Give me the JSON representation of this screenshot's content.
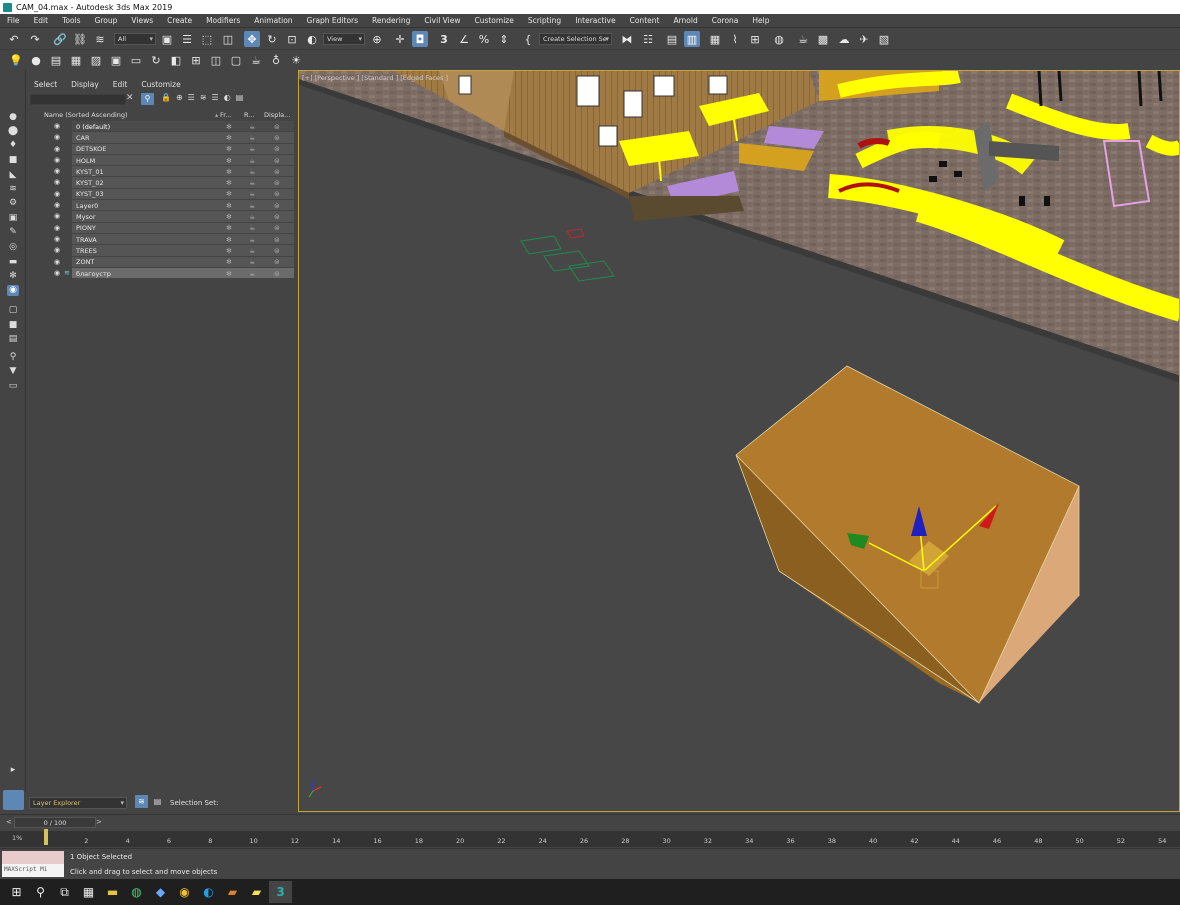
{
  "window": {
    "title": "CAM_04.max - Autodesk 3ds Max 2019"
  },
  "menu": [
    "File",
    "Edit",
    "Tools",
    "Group",
    "Views",
    "Create",
    "Modifiers",
    "Animation",
    "Graph Editors",
    "Rendering",
    "Civil View",
    "Customize",
    "Scripting",
    "Interactive",
    "Content",
    "Arnold",
    "Corona",
    "Help"
  ],
  "toolbar": {
    "selection_filter": "All",
    "ref_coord": "View",
    "named_selection": "Create Selection Se"
  },
  "scene_explorer": {
    "menu": [
      "Select",
      "Display",
      "Edit",
      "Customize"
    ],
    "columns": {
      "name": "Name (Sorted Ascending)",
      "freeze": "Fr...",
      "render": "R...",
      "display": "Displa..."
    },
    "layers": [
      "0 (default)",
      "CAR",
      "DETSKOE",
      "HOLM",
      "KYST_01",
      "KYST_02",
      "KYST_03",
      "Layer0",
      "Mysor",
      "PIONY",
      "TRAVA",
      "TREES",
      "ZONT",
      "благоустр"
    ],
    "bottom_dropdown": "Layer Explorer",
    "selection_set_label": "Selection Set:"
  },
  "viewport": {
    "label": "[+] [Perspective ] [Standard ] [Edged Faces ]"
  },
  "timeline": {
    "slider_text": "0 / 100",
    "ticks": [
      "0",
      "2",
      "4",
      "6",
      "8",
      "10",
      "12",
      "14",
      "16",
      "18",
      "20",
      "22",
      "24",
      "26",
      "28",
      "30",
      "32",
      "34",
      "36",
      "38",
      "40",
      "42",
      "44",
      "46",
      "48",
      "50",
      "52",
      "54"
    ],
    "corner_label": "1%"
  },
  "status": {
    "maxscript_label": "MAXScript Mi",
    "selected": "1 Object Selected",
    "prompt": "Click and drag to select and move objects"
  },
  "colors": {
    "accent": "#5d87b5",
    "viewport_border": "#c8a23a",
    "box_top": "#b27a2c",
    "flower_yellow": "#ffff00"
  }
}
